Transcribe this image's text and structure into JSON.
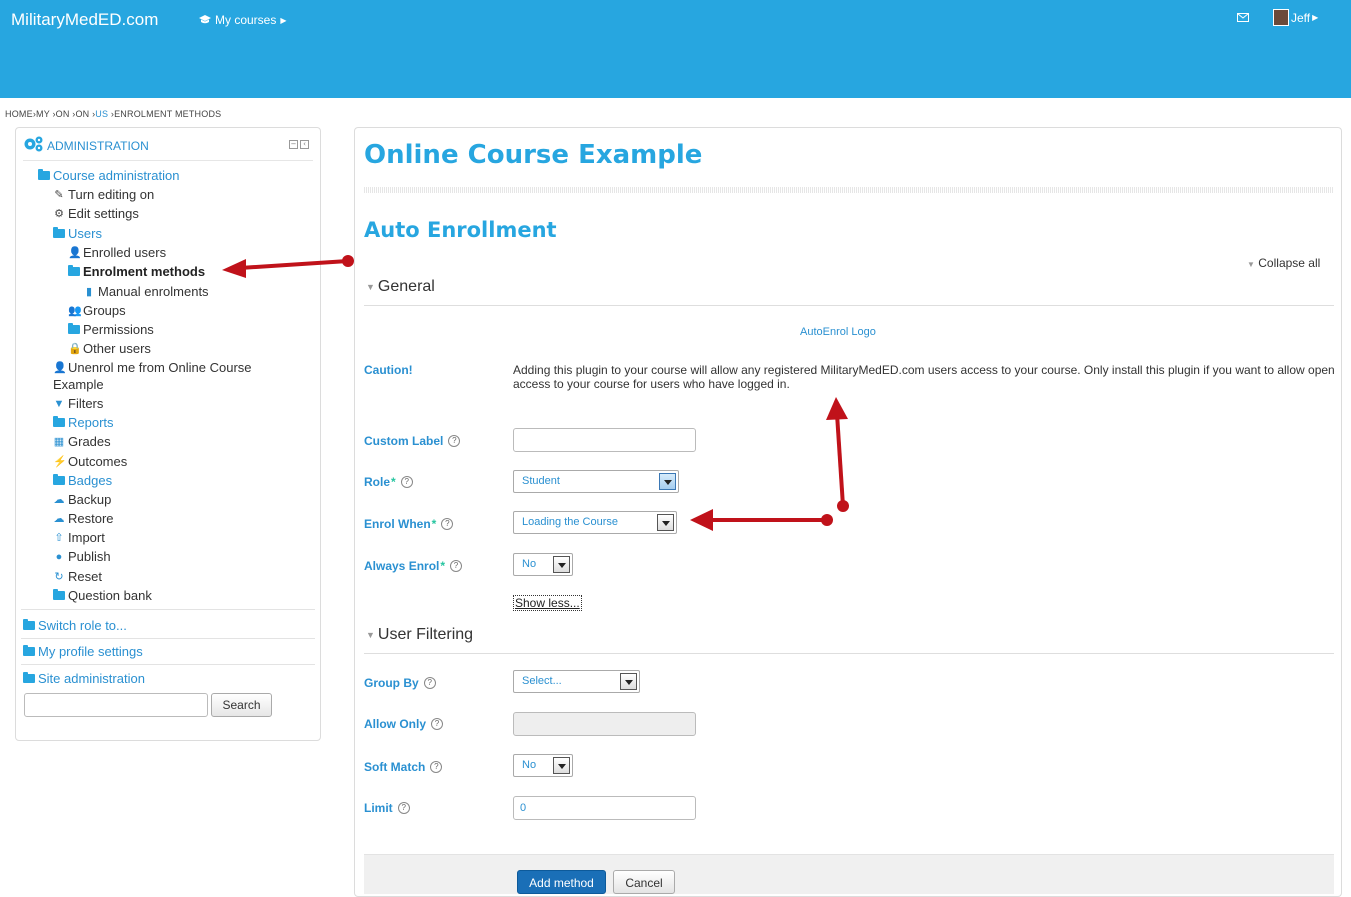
{
  "header": {
    "brand": "MilitaryMedED.com",
    "my_courses": "My courses",
    "user_name": "Jeff"
  },
  "breadcrumb": {
    "home": "HOME",
    "my": "MY",
    "on1": "ON",
    "on2": "ON",
    "us": "US",
    "current": "ENROLMENT METHODS"
  },
  "sidebar": {
    "title": "ADMINISTRATION",
    "course_admin": "Course administration",
    "turn_editing": "Turn editing on",
    "edit_settings": "Edit settings",
    "users": "Users",
    "enrolled_users": "Enrolled users",
    "enrolment_methods": "Enrolment methods",
    "manual_enrolments": "Manual enrolments",
    "groups": "Groups",
    "permissions": "Permissions",
    "other_users": "Other users",
    "unenrol_line1": "Unenrol me from Online Course",
    "unenrol_line2": "Example",
    "filters": "Filters",
    "reports": "Reports",
    "grades": "Grades",
    "outcomes": "Outcomes",
    "badges": "Badges",
    "backup": "Backup",
    "restore": "Restore",
    "import": "Import",
    "publish": "Publish",
    "reset": "Reset",
    "question_bank": "Question bank",
    "switch_role": "Switch role to...",
    "profile_settings": "My profile settings",
    "site_admin": "Site administration",
    "search_value": "",
    "search_button": "Search"
  },
  "main": {
    "course_title": "Online Course Example",
    "page_title": "Auto Enrollment",
    "collapse_all": "Collapse all",
    "general_legend": "General",
    "logo_link": "AutoEnrol Logo",
    "caution_label": "Caution!",
    "caution_text": "Adding this plugin to your course will allow any registered MilitaryMedED.com users access to your course. Only install this plugin if you want to allow open access to your course for users who have logged in.",
    "custom_label": "Custom Label",
    "custom_label_value": "",
    "role_label": "Role",
    "role_value": "Student",
    "enrol_when_label": "Enrol When",
    "enrol_when_value": "Loading the Course",
    "always_enrol_label": "Always Enrol",
    "always_enrol_value": "No",
    "show_less": "Show less...",
    "user_filtering_legend": "User Filtering",
    "group_by_label": "Group By",
    "group_by_value": "Select...",
    "allow_only_label": "Allow Only",
    "allow_only_value": "",
    "soft_match_label": "Soft Match",
    "soft_match_value": "No",
    "limit_label": "Limit",
    "limit_value": "0",
    "add_button": "Add method",
    "cancel_button": "Cancel"
  },
  "colors": {
    "header_blue": "#27a6e0",
    "link_blue": "#2a90d1",
    "annotation_red": "#c0121a"
  }
}
